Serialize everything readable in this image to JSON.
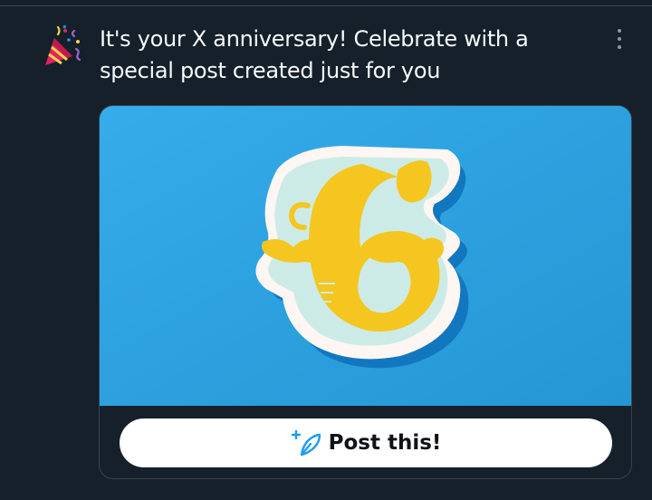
{
  "notification": {
    "icon": "party-popper-icon",
    "text": "It's your X anniversary! Celebrate with a special post created just for you"
  },
  "menu": {
    "icon": "more-vertical-icon"
  },
  "card": {
    "image": {
      "subject": "papercraft-number-six",
      "background_color": "#2ea3df",
      "figure_color": "#f4c61f"
    },
    "button": {
      "icon": "feather-sparkle-icon",
      "label": "Post this!"
    }
  },
  "colors": {
    "background": "#15202b",
    "text": "#f7f9f9",
    "muted": "#8b98a5",
    "border": "#38444d",
    "accent": "#1d9bf0"
  }
}
